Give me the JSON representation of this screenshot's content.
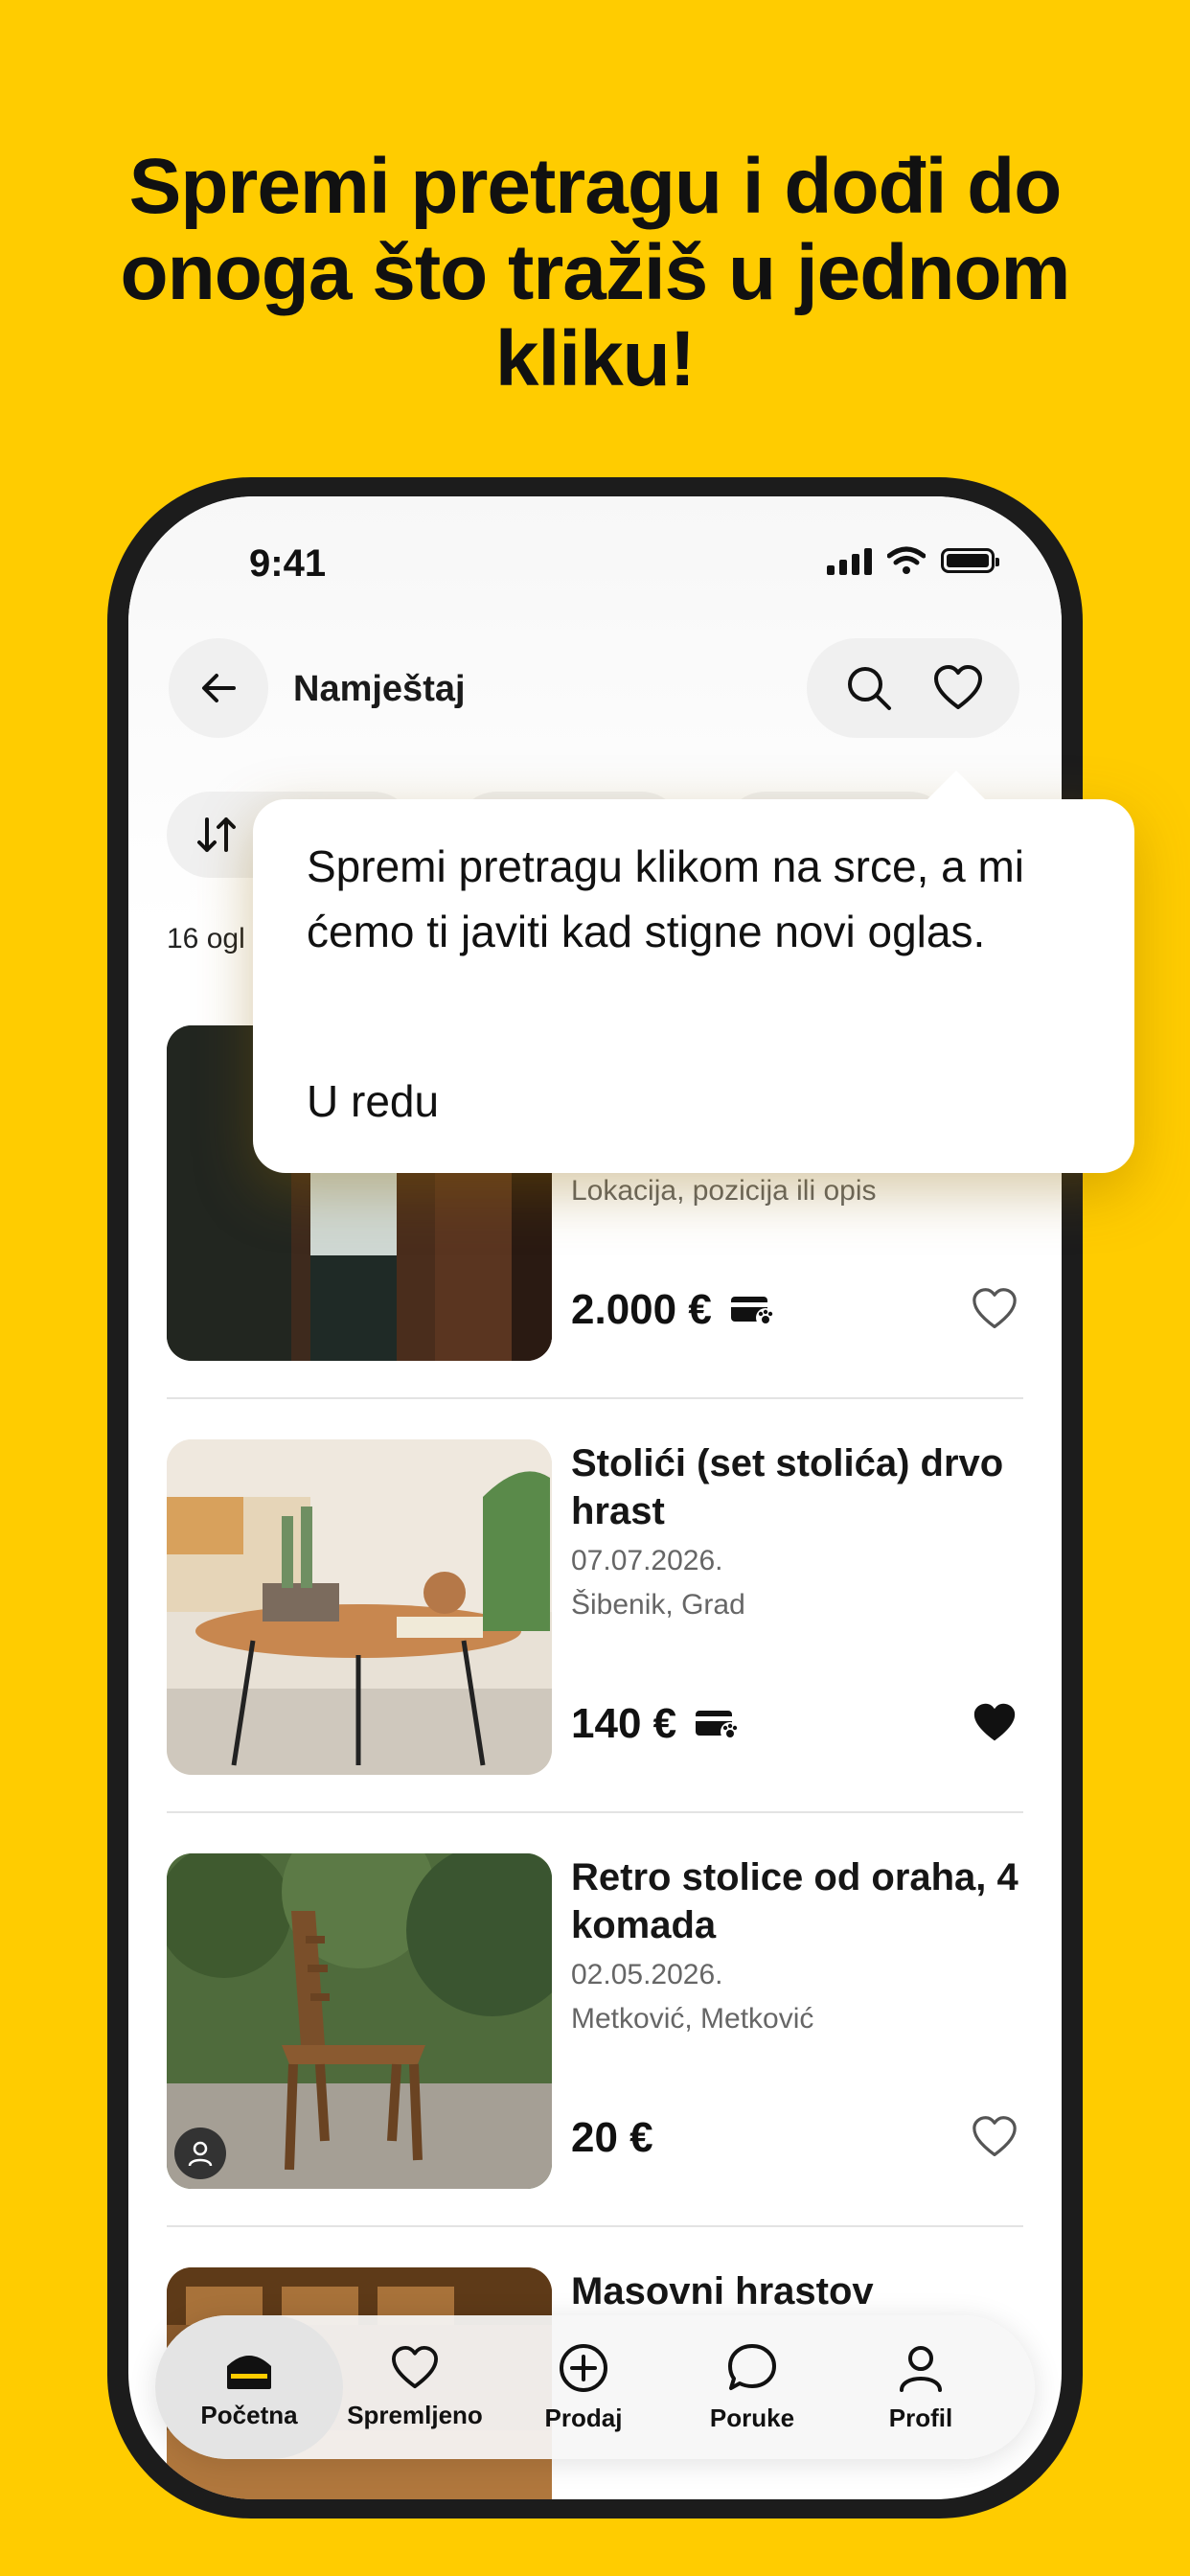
{
  "headline": "Spremi pretragu i dođi do onoga što tražiš u jednom kliku!",
  "status_bar": {
    "time": "9:41"
  },
  "header": {
    "title": "Namještaj"
  },
  "results": {
    "count_text": "16 ogl"
  },
  "tooltip": {
    "text": "Spremi pretragu klikom na srce, a mi ćemo ti javiti kad stigne novi oglas.",
    "ok_label": "U redu"
  },
  "listings": [
    {
      "title": "",
      "date": "",
      "location": "Lokacija, pozicija ili opis",
      "price": "2.000 €",
      "card_icon": true,
      "favorited": false
    },
    {
      "title": "Stolići (set stolića) drvo hrast",
      "date": "07.07.2026.",
      "location": "Šibenik, Grad",
      "price": "140 €",
      "card_icon": true,
      "favorited": true
    },
    {
      "title": "Retro stolice od oraha, 4 komada",
      "date": "02.05.2026.",
      "location": "Metković, Metković",
      "price": "20 €",
      "card_icon": false,
      "favorited": false
    },
    {
      "title": "Masovni hrastov",
      "date": "",
      "location": "",
      "price": "",
      "card_icon": false,
      "favorited": false
    }
  ],
  "tabbar": {
    "items": [
      {
        "label": "Početna",
        "icon": "home-icon",
        "active": true
      },
      {
        "label": "Spremljeno",
        "icon": "heart-icon",
        "active": false
      },
      {
        "label": "Prodaj",
        "icon": "plus-circle-icon",
        "active": false
      },
      {
        "label": "Poruke",
        "icon": "chat-bubble-icon",
        "active": false
      },
      {
        "label": "Profil",
        "icon": "user-icon",
        "active": false
      }
    ]
  },
  "colors": {
    "brand_yellow": "#FFCC00",
    "text_dark": "#111111"
  }
}
